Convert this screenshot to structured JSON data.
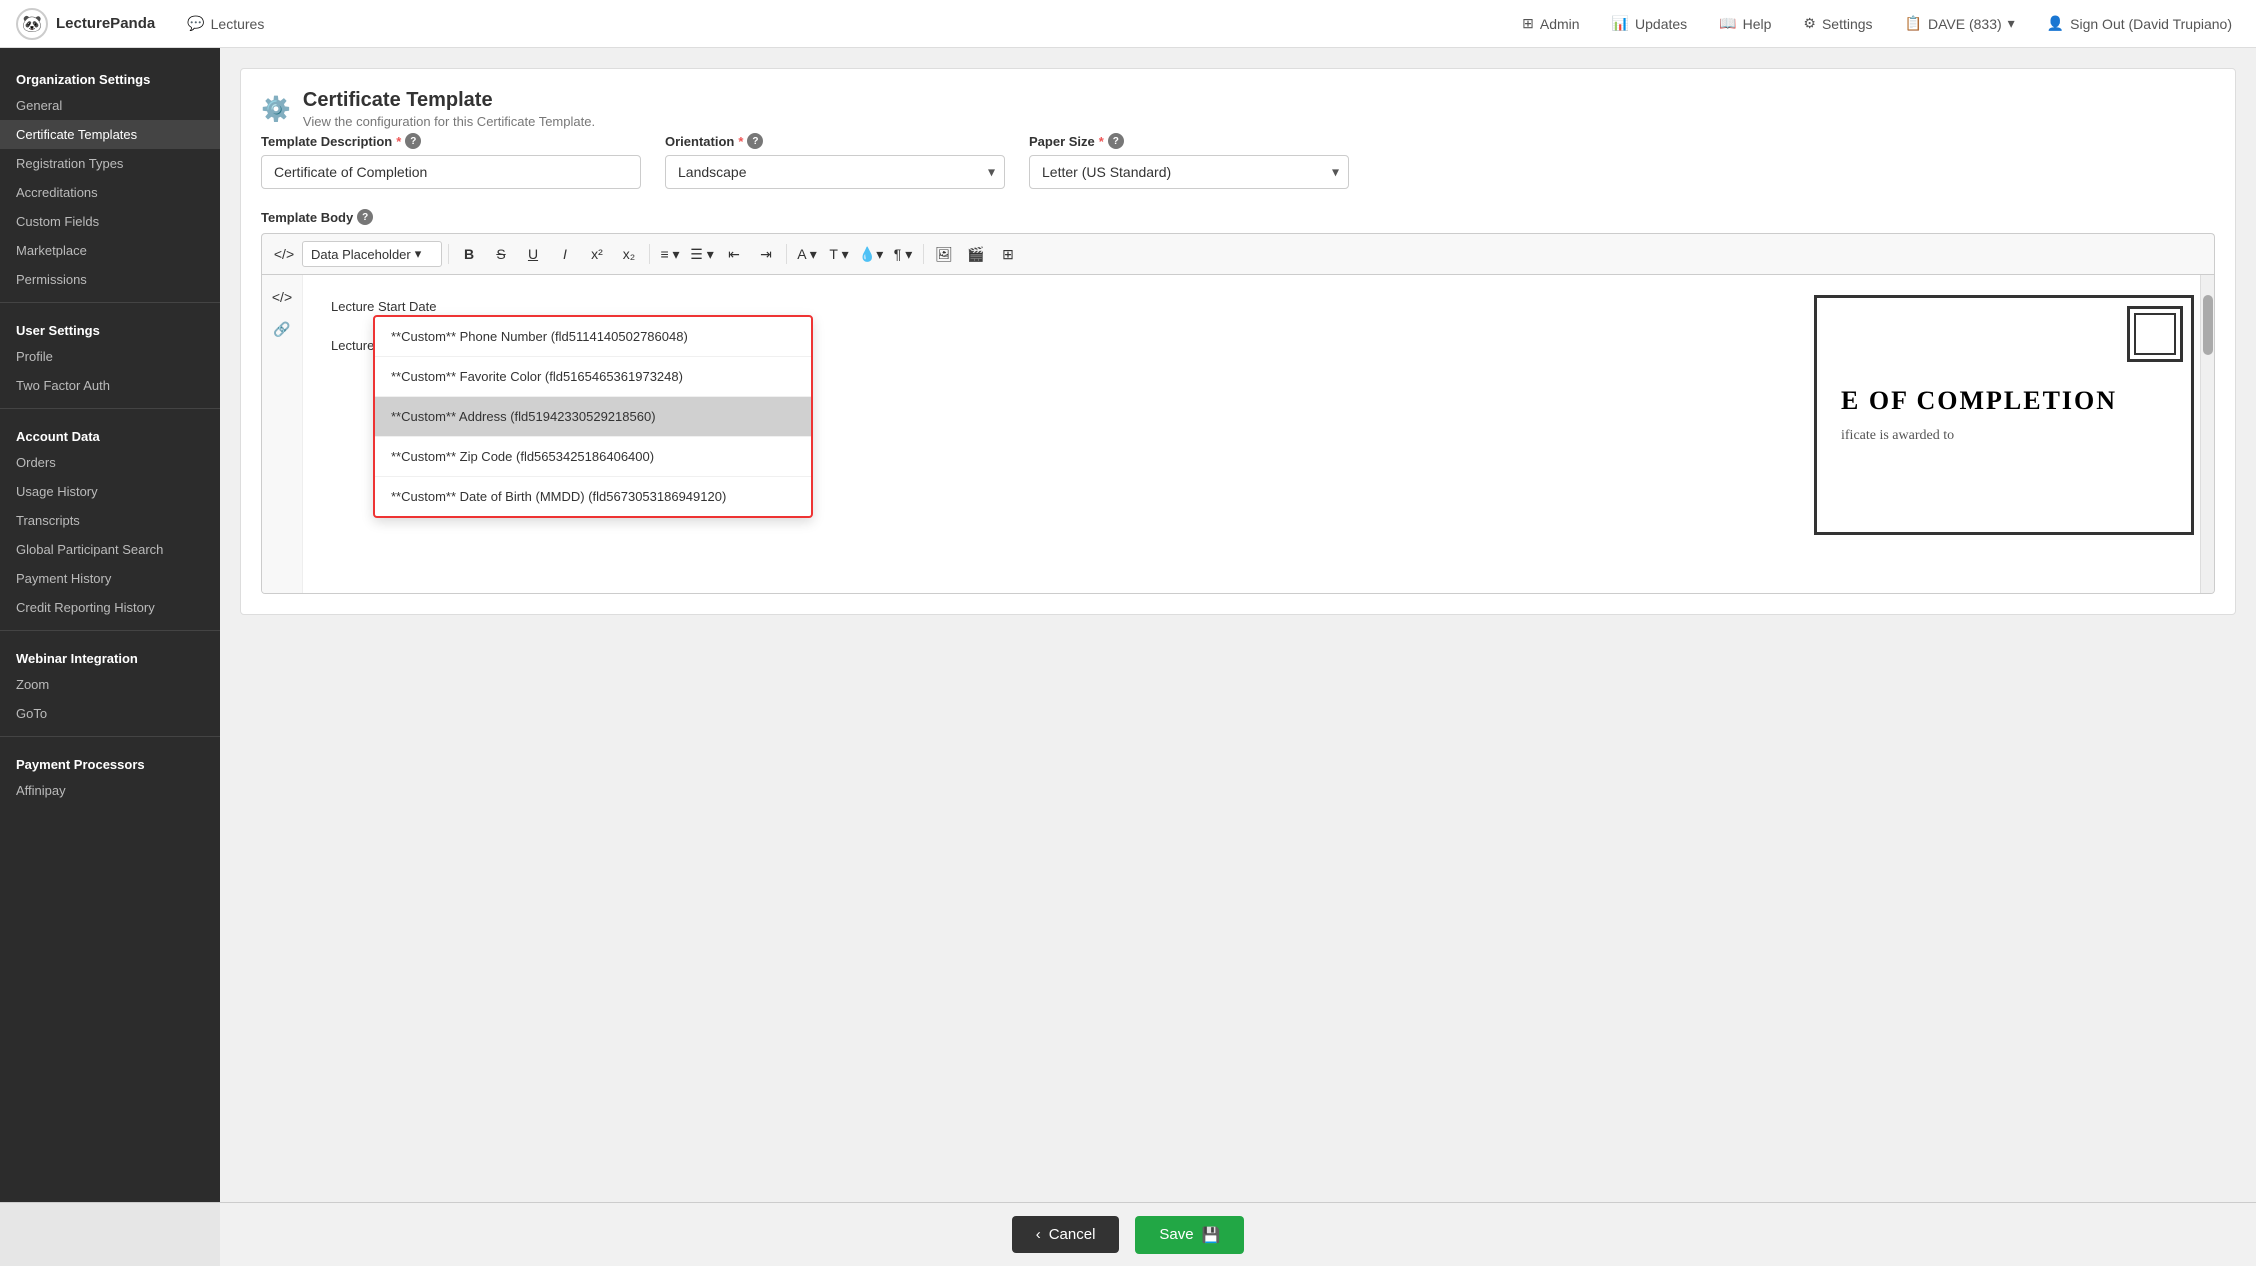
{
  "nav": {
    "brand": "LecturePanda",
    "brand_icon": "🐼",
    "lectures_label": "Lectures",
    "admin_label": "Admin",
    "updates_label": "Updates",
    "help_label": "Help",
    "settings_label": "Settings",
    "dave_label": "DAVE (833)",
    "signout_label": "Sign Out (David Trupiano)"
  },
  "sidebar": {
    "org_section": "Organization Settings",
    "items_org": [
      "General",
      "Certificate Templates",
      "Registration Types",
      "Accreditations",
      "Custom Fields",
      "Marketplace",
      "Permissions"
    ],
    "user_section": "User Settings",
    "items_user": [
      "Profile",
      "Two Factor Auth"
    ],
    "account_section": "Account Data",
    "items_account": [
      "Orders",
      "Usage History",
      "Transcripts",
      "Global Participant Search",
      "Payment History",
      "Credit Reporting History"
    ],
    "webinar_section": "Webinar Integration",
    "items_webinar": [
      "Zoom",
      "GoTo"
    ],
    "payment_section": "Payment Processors",
    "items_payment": [
      "Affinipay"
    ]
  },
  "page": {
    "card_title": "Certificate Template",
    "card_subtitle": "View the configuration for this Certificate Template.",
    "template_desc_label": "Template Description",
    "template_desc_value": "Certificate of Completion",
    "orientation_label": "Orientation",
    "orientation_value": "Landscape",
    "paper_label": "Paper Size",
    "paper_value": "Letter (US Standard)",
    "template_body_label": "Template Body",
    "toolbar_placeholder_label": "Data Placeholder",
    "dd_above_items": [
      "Lecture Start Date",
      "Lecture Start Date and Time"
    ],
    "dropdown_items": [
      "**Custom** Phone Number (fld5114140502786048)",
      "**Custom** Favorite Color (fld5165465361973248)",
      "**Custom** Address (fld51942330529218560)",
      "**Custom** Zip Code (fld5653425186406400)",
      "**Custom** Date of Birth (MMDD) (fld5673053186949120)"
    ],
    "highlighted_item_index": 2,
    "cert_preview_title": "E OF COMPLETION",
    "cert_preview_sub": "ificate is awarded to",
    "cancel_label": "Cancel",
    "save_label": "Save"
  }
}
